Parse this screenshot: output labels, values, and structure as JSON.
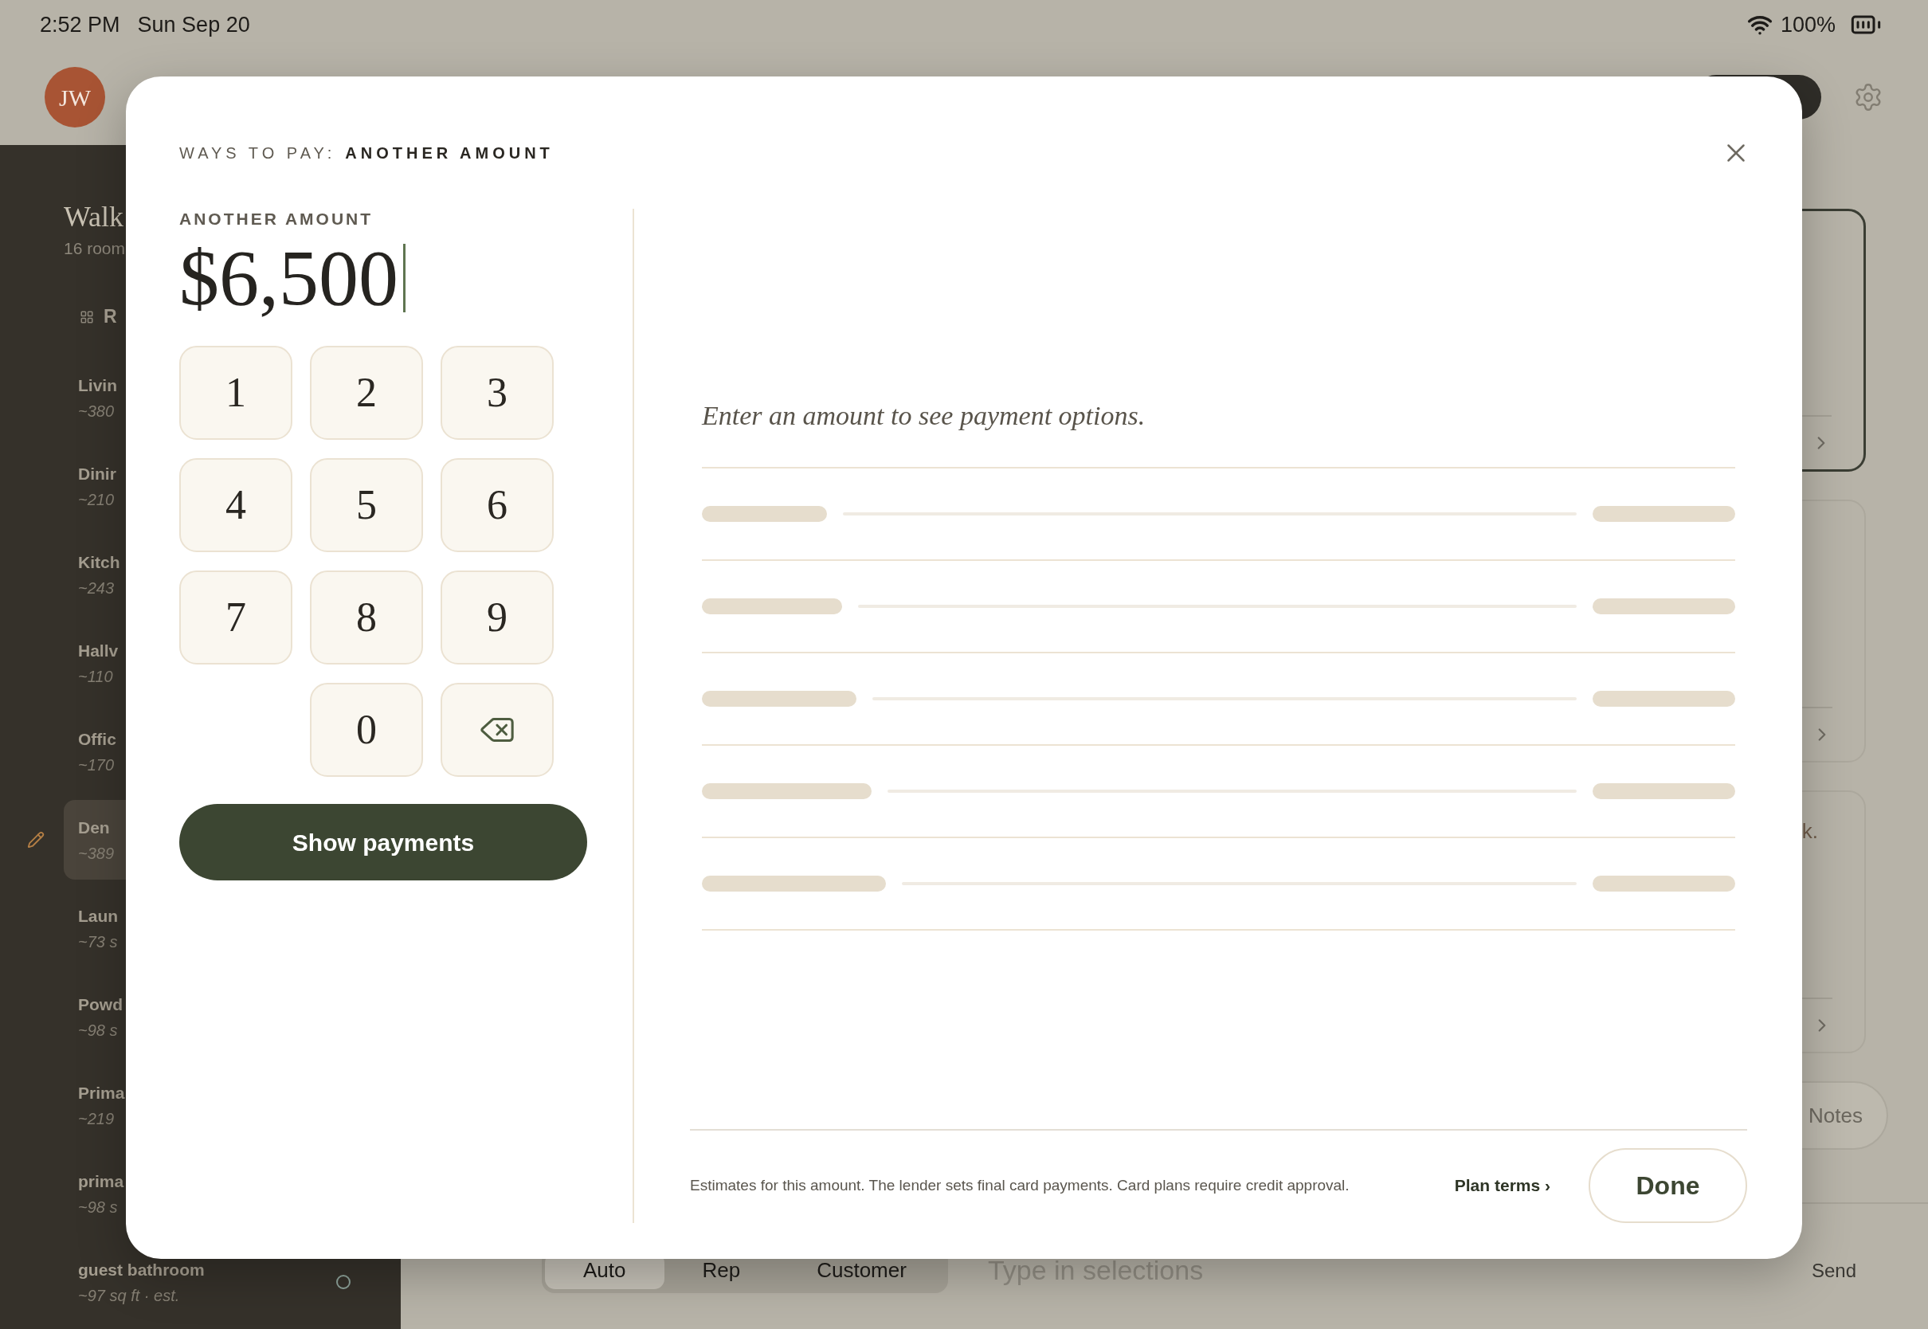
{
  "status_bar": {
    "time": "2:52 PM",
    "date": "Sun Sep 20",
    "battery": "100%"
  },
  "header": {
    "avatar": "JW"
  },
  "sidebar": {
    "title": "Walk",
    "subtitle": "16 room",
    "section": "R",
    "rooms": [
      {
        "name": "Livin",
        "area": "~380",
        "selected": false
      },
      {
        "name": "Dinir",
        "area": "~210",
        "selected": false
      },
      {
        "name": "Kitch",
        "area": "~243",
        "selected": false
      },
      {
        "name": "Hallv",
        "area": "~110",
        "selected": false
      },
      {
        "name": "Offic",
        "area": "~170",
        "selected": false
      },
      {
        "name": "Den",
        "area": "~389",
        "selected": true
      },
      {
        "name": "Laun",
        "area": "~73 s",
        "selected": false
      },
      {
        "name": "Powd",
        "area": "~98 s",
        "selected": false
      },
      {
        "name": "Prima",
        "area": "~219",
        "selected": false
      },
      {
        "name": "prima",
        "area": "~98 s",
        "selected": false
      },
      {
        "name": "guest bathroom",
        "area": "~97 sq ft · est.",
        "selected": false,
        "status_ring": true
      }
    ]
  },
  "cards": [
    {
      "selected": true
    },
    {
      "selected": false
    },
    {
      "selected": false,
      "text": "k."
    }
  ],
  "notes_button": "Notes",
  "composer": {
    "modes": [
      {
        "label": "Auto",
        "selected": true
      },
      {
        "label": "Rep",
        "selected": false
      },
      {
        "label": "Customer",
        "selected": false
      }
    ],
    "placeholder": "Type in selections",
    "send": "Send"
  },
  "dialog": {
    "breadcrumb": "WAYS TO PAY:",
    "title": "ANOTHER AMOUNT",
    "amount_label": "ANOTHER AMOUNT",
    "amount": "$6,500",
    "keys": [
      {
        "kind": "digit",
        "label": "1"
      },
      {
        "kind": "digit",
        "label": "2"
      },
      {
        "kind": "digit",
        "label": "3"
      },
      {
        "kind": "digit",
        "label": "4"
      },
      {
        "kind": "digit",
        "label": "5"
      },
      {
        "kind": "digit",
        "label": "6"
      },
      {
        "kind": "digit",
        "label": "7"
      },
      {
        "kind": "digit",
        "label": "8"
      },
      {
        "kind": "digit",
        "label": "9"
      },
      {
        "kind": "blank"
      },
      {
        "kind": "digit",
        "label": "0"
      },
      {
        "kind": "backspace"
      }
    ],
    "submit": "Show payments",
    "hint": "Enter an amount to see payment options.",
    "footnote": "Estimates for this amount. The lender sets final card payments. Card plans require credit approval.",
    "link": "Plan terms ›",
    "done": "Done"
  }
}
